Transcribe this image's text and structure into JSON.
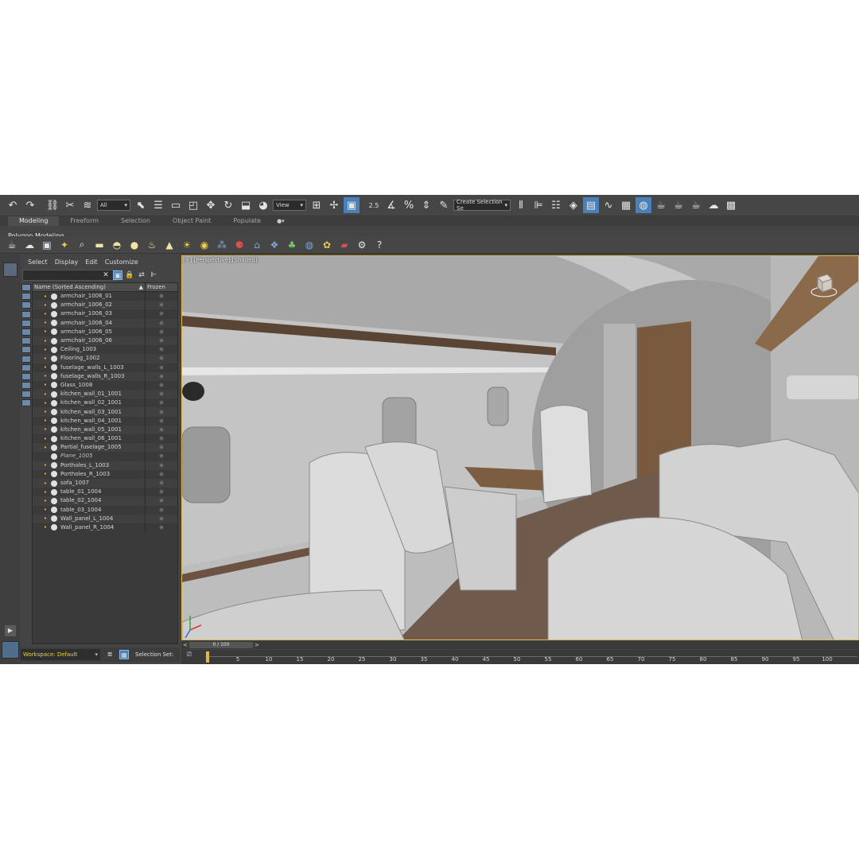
{
  "toolbar": {
    "selection_filter": "All",
    "reference_coord": "View",
    "snap_value": "2.5",
    "named_selection": "Create Selection Se"
  },
  "ribbon": {
    "tabs": [
      "Modeling",
      "Freeform",
      "Selection",
      "Object Paint",
      "Populate"
    ],
    "active_tab": "Modeling",
    "sub_label": "Polygon Modeling"
  },
  "explorer": {
    "menu": [
      "Select",
      "Display",
      "Edit",
      "Customize"
    ],
    "column_name": "Name (Sorted Ascending)",
    "column_frozen": "Frozen",
    "objects": [
      {
        "name": "armchair_1006_01",
        "hidden": false
      },
      {
        "name": "armchair_1006_02",
        "hidden": false
      },
      {
        "name": "armchair_1006_03",
        "hidden": false
      },
      {
        "name": "armchair_1006_04",
        "hidden": false
      },
      {
        "name": "armchair_1006_05",
        "hidden": false
      },
      {
        "name": "armchair_1006_06",
        "hidden": false
      },
      {
        "name": "Ceiling_1003",
        "hidden": false
      },
      {
        "name": "Flooring_1002",
        "hidden": false
      },
      {
        "name": "fuselage_walls_L_1003",
        "hidden": false
      },
      {
        "name": "fuselage_walls_R_1003",
        "hidden": false
      },
      {
        "name": "Glass_1008",
        "hidden": false
      },
      {
        "name": "kitchen_wall_01_1001",
        "hidden": false
      },
      {
        "name": "kitchen_wall_02_1001",
        "hidden": false
      },
      {
        "name": "kitchen_wall_03_1001",
        "hidden": false
      },
      {
        "name": "kitchen_wall_04_1001",
        "hidden": false
      },
      {
        "name": "kitchen_wall_05_1001",
        "hidden": false
      },
      {
        "name": "kitchen_wall_06_1001",
        "hidden": false
      },
      {
        "name": "Partial_fuselage_1005",
        "hidden": false
      },
      {
        "name": "Plane_1005",
        "hidden": true
      },
      {
        "name": "Portholes_L_1003",
        "hidden": false
      },
      {
        "name": "Portholes_R_1003",
        "hidden": false
      },
      {
        "name": "sofa_1007",
        "hidden": false
      },
      {
        "name": "table_01_1004",
        "hidden": false
      },
      {
        "name": "table_02_1004",
        "hidden": false
      },
      {
        "name": "table_03_1004",
        "hidden": false
      },
      {
        "name": "Wall_panel_L_1004",
        "hidden": false
      },
      {
        "name": "Wall_panel_R_1004",
        "hidden": false
      }
    ]
  },
  "workspace": {
    "label": "Workspace: Default",
    "selection_set": "Selection Set:"
  },
  "viewport": {
    "label": "[+] [Perspective] [Shaded]"
  },
  "timeline": {
    "frame_display": "0 / 100",
    "prev": "<",
    "next": ">",
    "ticks": [
      "5",
      "10",
      "15",
      "20",
      "25",
      "30",
      "35",
      "40",
      "45",
      "50",
      "55",
      "60",
      "65",
      "70",
      "75",
      "80",
      "85",
      "90",
      "95",
      "100"
    ]
  },
  "colors": {
    "accent": "#4a80b8",
    "viewport_border": "#e0b84a",
    "workspace_text": "#e8d247"
  }
}
